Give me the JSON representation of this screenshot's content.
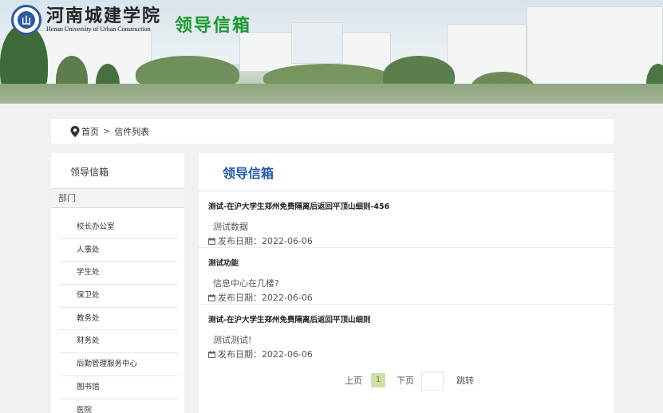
{
  "header": {
    "school_cn": "河南城建学院",
    "school_en": "Henan University of Urban Construction",
    "logo_char": "山",
    "title": "领导信箱"
  },
  "breadcrumb": {
    "home": "首页",
    "separator": ">",
    "current": "信件列表"
  },
  "sidebar": {
    "title": "领导信箱",
    "dept_label": "部门",
    "items": [
      {
        "label": "校长办公室"
      },
      {
        "label": "人事处"
      },
      {
        "label": "学生处"
      },
      {
        "label": "保卫处"
      },
      {
        "label": "教务处"
      },
      {
        "label": "财务处"
      },
      {
        "label": "后勤管理服务中心"
      },
      {
        "label": "图书馆"
      },
      {
        "label": "医院"
      }
    ]
  },
  "main": {
    "title": "领导信箱",
    "date_prefix": "发布日期：",
    "letters": [
      {
        "title": "测试-在沪大学生郑州免费隔离后返回平顶山细则-456",
        "content": "测试数据",
        "date": "2022-06-06"
      },
      {
        "title": "测试功能",
        "content": "信息中心在几楼?",
        "date": "2022-06-06"
      },
      {
        "title": "测试-在沪大学生郑州免费隔离后返回平顶山细则",
        "content": "测试测试!",
        "date": "2022-06-06"
      }
    ]
  },
  "pager": {
    "prev": "上页",
    "current": "1",
    "next": "下页",
    "jump": "跳转"
  },
  "colors": {
    "title_blue": "#1f5aa6",
    "banner_green": "#1a9a2e",
    "pager_active": "#cfe0a7"
  }
}
